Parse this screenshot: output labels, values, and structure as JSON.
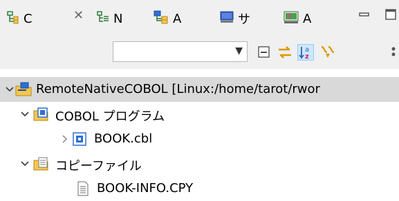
{
  "tabs": [
    {
      "id": "tab-1",
      "label": "C",
      "icon": "hierarchy-icon"
    },
    {
      "id": "tab-2",
      "label": "N",
      "icon": "navigator-icon"
    },
    {
      "id": "tab-3",
      "label": "A",
      "icon": "remote-systems-icon"
    },
    {
      "id": "tab-4",
      "label": "サ",
      "icon": "server-icon"
    },
    {
      "id": "tab-5",
      "label": "A",
      "icon": "console-icon"
    }
  ],
  "toolbar": {
    "filter_value": "",
    "buttons": [
      "collapse-all-icon",
      "link-with-editor-icon",
      "sort-alphabetically-icon",
      "filter-icon"
    ]
  },
  "tree": [
    {
      "label": "RemoteNativeCOBOL [Linux:/home/tarot/rwor",
      "icon": "remote-project-icon",
      "expanded": true
    },
    {
      "label": "COBOL プログラム",
      "icon": "cobol-folder-icon",
      "expanded": true
    },
    {
      "label": "BOOK.cbl",
      "icon": "cobol-file-icon",
      "expanded": false
    },
    {
      "label": "コピーファイル",
      "icon": "copybook-folder-icon",
      "expanded": true
    },
    {
      "label": "BOOK-INFO.CPY",
      "icon": "file-icon"
    }
  ],
  "colors": {
    "selection": "#d9d9d9",
    "toolbar_bg": "#f0f0f0",
    "folder": "#f5c64f",
    "accent_blue": "#2f6fd6"
  }
}
